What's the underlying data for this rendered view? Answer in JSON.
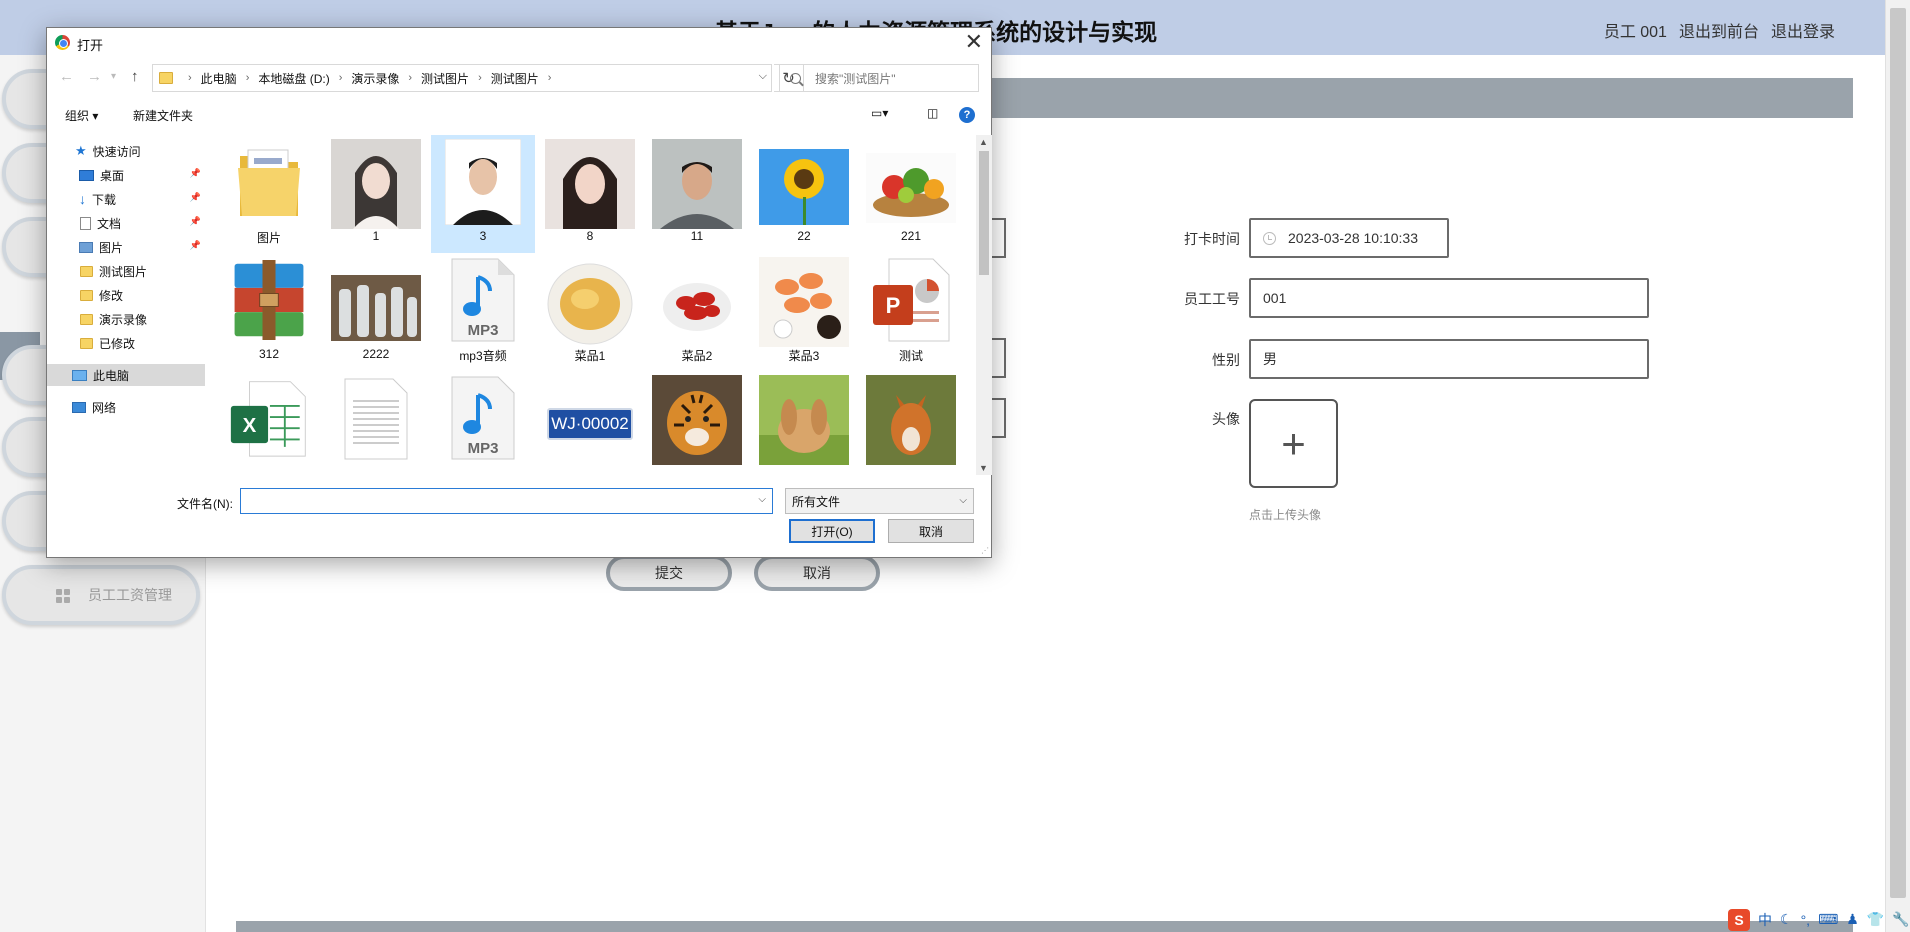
{
  "app": {
    "title": "基于Java的人力资源管理系统的设计与实现",
    "header_links": [
      "员工 001",
      "退出到前台",
      "退出登录"
    ]
  },
  "sidebar": {
    "last_item_label": "员工工资管理"
  },
  "form": {
    "clock_time_label": "打卡时间",
    "clock_time_value": "2023-03-28 10:10:33",
    "employee_no_label": "员工工号",
    "employee_no_value": "001",
    "gender_label": "性别",
    "gender_value": "男",
    "avatar_label": "头像",
    "avatar_hint": "点击上传头像",
    "submit_label": "提交",
    "cancel_label": "取消"
  },
  "dialog": {
    "title": "打开",
    "breadcrumbs": [
      "此电脑",
      "本地磁盘 (D:)",
      "演示录像",
      "测试图片",
      "测试图片"
    ],
    "search_placeholder": "搜索\"测试图片\"",
    "organize_label": "组织",
    "new_folder_label": "新建文件夹",
    "nav_items": [
      {
        "label": "快速访问",
        "icon": "star-icon"
      },
      {
        "label": "桌面",
        "icon": "desktop-icon",
        "pinned": true
      },
      {
        "label": "下载",
        "icon": "download-icon",
        "pinned": true
      },
      {
        "label": "文档",
        "icon": "document-icon",
        "pinned": true
      },
      {
        "label": "图片",
        "icon": "pictures-icon",
        "pinned": true
      },
      {
        "label": "测试图片",
        "icon": "folder-icon"
      },
      {
        "label": "修改",
        "icon": "folder-icon"
      },
      {
        "label": "演示录像",
        "icon": "folder-icon"
      },
      {
        "label": "已修改",
        "icon": "folder-icon"
      },
      {
        "label": "此电脑",
        "icon": "pc-icon",
        "selected": true
      },
      {
        "label": "网络",
        "icon": "network-icon"
      }
    ],
    "files": [
      {
        "name": "图片",
        "kind": "folder"
      },
      {
        "name": "1",
        "kind": "photo-woman"
      },
      {
        "name": "3",
        "kind": "photo-man",
        "selected": true
      },
      {
        "name": "8",
        "kind": "photo-woman2"
      },
      {
        "name": "11",
        "kind": "photo-man2"
      },
      {
        "name": "22",
        "kind": "sunflower"
      },
      {
        "name": "221",
        "kind": "vegetables"
      },
      {
        "name": "312",
        "kind": "winrar"
      },
      {
        "name": "2222",
        "kind": "bottles"
      },
      {
        "name": "mp3音频",
        "kind": "mp3"
      },
      {
        "name": "菜品1",
        "kind": "dish-chicken"
      },
      {
        "name": "菜品2",
        "kind": "dish-crayfish"
      },
      {
        "name": "菜品3",
        "kind": "dish-shrimp"
      },
      {
        "name": "测试",
        "kind": "pptx"
      },
      {
        "name": "",
        "kind": "excel"
      },
      {
        "name": "",
        "kind": "textdoc"
      },
      {
        "name": "",
        "kind": "mp3"
      },
      {
        "name": "",
        "kind": "plate",
        "plate_text": "WJ·00002"
      },
      {
        "name": "",
        "kind": "tiger"
      },
      {
        "name": "",
        "kind": "rabbit"
      },
      {
        "name": "",
        "kind": "fox"
      }
    ],
    "filename_label": "文件名(N):",
    "filename_value": "",
    "filetype_value": "所有文件",
    "open_label": "打开(O)",
    "cancel_label": "取消"
  },
  "tray": {
    "ime": "中"
  }
}
